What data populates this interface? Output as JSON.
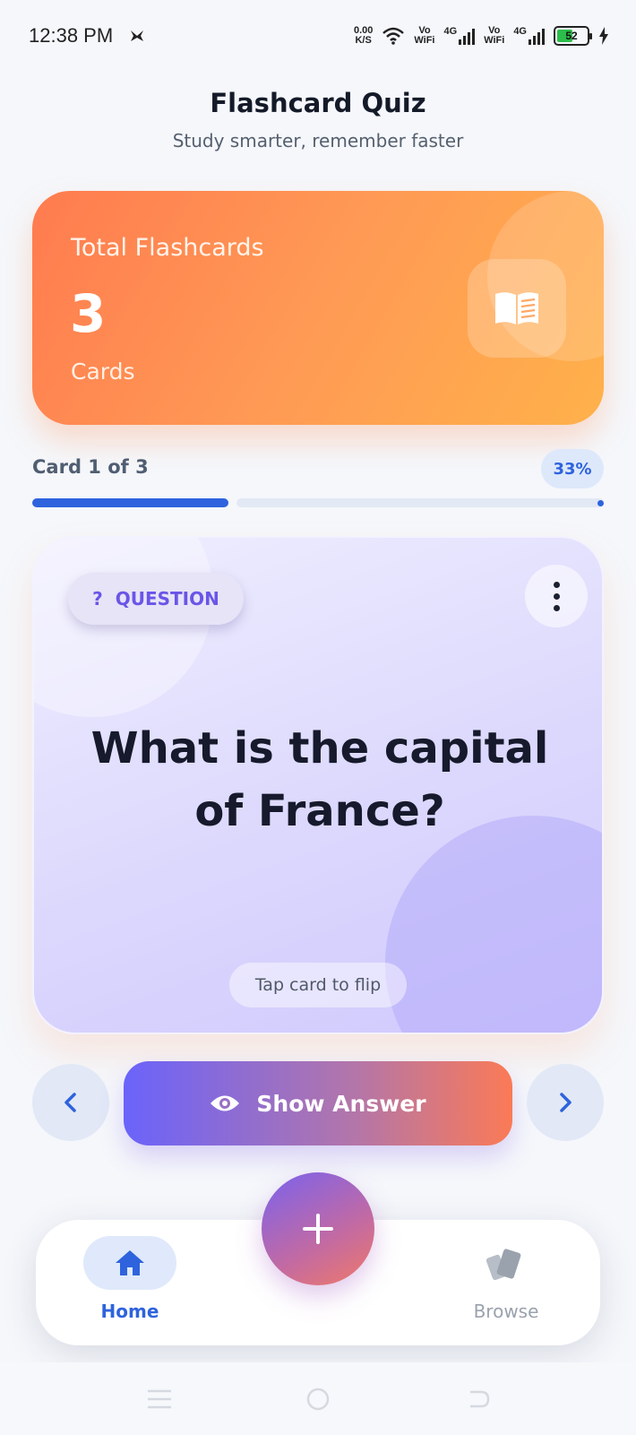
{
  "status_bar": {
    "time": "12:38 PM",
    "net_speed_value": "0.00",
    "net_speed_unit": "K/S",
    "vo_label": "Vo",
    "wifi_label": "WiFi",
    "network_type": "4G",
    "battery_level": "52"
  },
  "header": {
    "title": "Flashcard Quiz",
    "subtitle": "Study smarter, remember faster"
  },
  "stats": {
    "label": "Total Flashcards",
    "value": "3",
    "unit": "Cards",
    "icon": "open-book-icon"
  },
  "progress": {
    "label": "Card 1 of 3",
    "percent_label": "33%",
    "fraction": 0.33
  },
  "flashcard": {
    "badge_symbol": "?",
    "badge_label": "QUESTION",
    "question": "What is the capital of France?",
    "hint": "Tap card to flip"
  },
  "controls": {
    "prev_icon": "chevron-left-icon",
    "next_icon": "chevron-right-icon",
    "show_answer_label": "Show Answer",
    "show_answer_icon": "eye-icon"
  },
  "bottom_nav": {
    "home_label": "Home",
    "browse_label": "Browse",
    "fab_icon": "plus-icon"
  },
  "colors": {
    "accent": "#2e63dd",
    "stat_card_start": "#ff7b4f",
    "stat_card_end": "#ffb14a",
    "badge_text": "#6a55e8"
  }
}
